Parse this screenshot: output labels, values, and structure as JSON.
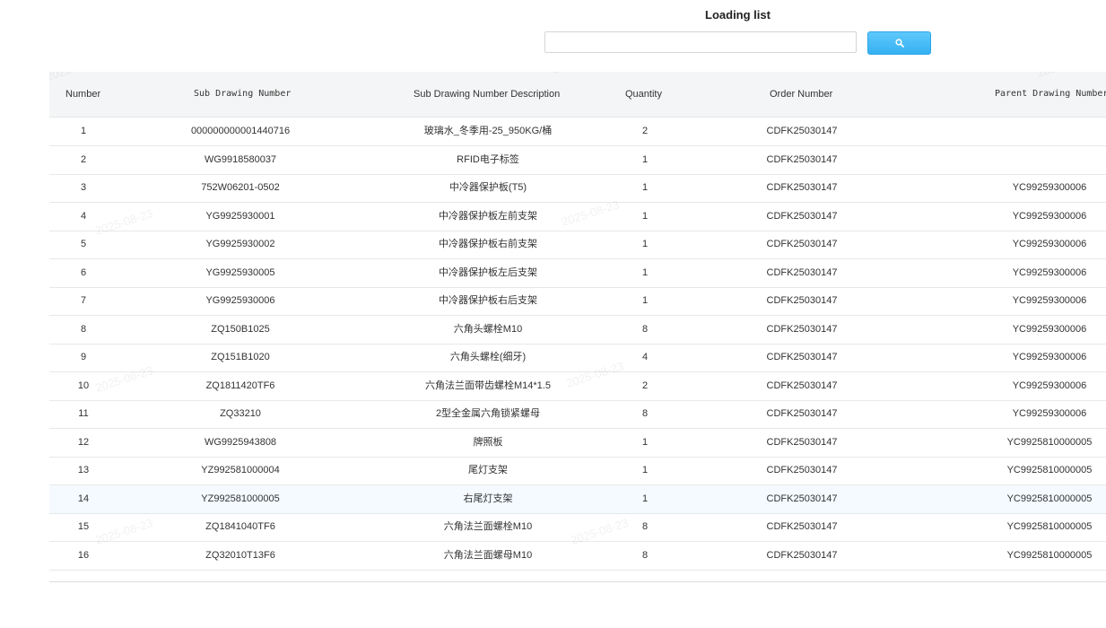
{
  "header": {
    "title": "Loading list"
  },
  "search": {
    "value": "",
    "placeholder": ""
  },
  "colors": {
    "accent": "#3ab4f4",
    "header_bg": "#f4f5f6",
    "highlight_row": "#f4faff"
  },
  "table": {
    "columns": {
      "number": "Number",
      "sub_drawing_number": "Sub Drawing Number",
      "description": "Sub Drawing Number Description",
      "quantity": "Quantity",
      "order_number": "Order Number",
      "parent_drawing_number": "Parent Drawing Number"
    },
    "rows": [
      {
        "number": "1",
        "sub": "000000000001440716",
        "desc": "玻璃水_冬季用-25_950KG/桶",
        "qty": "2",
        "order": "CDFK25030147",
        "parent": ""
      },
      {
        "number": "2",
        "sub": "WG9918580037",
        "desc": "RFID电子标签",
        "qty": "1",
        "order": "CDFK25030147",
        "parent": ""
      },
      {
        "number": "3",
        "sub": "752W06201-0502",
        "desc": "中冷器保护板(T5)",
        "qty": "1",
        "order": "CDFK25030147",
        "parent": "YC99259300006"
      },
      {
        "number": "4",
        "sub": "YG9925930001",
        "desc": "中冷器保护板左前支架",
        "qty": "1",
        "order": "CDFK25030147",
        "parent": "YC99259300006"
      },
      {
        "number": "5",
        "sub": "YG9925930002",
        "desc": "中冷器保护板右前支架",
        "qty": "1",
        "order": "CDFK25030147",
        "parent": "YC99259300006"
      },
      {
        "number": "6",
        "sub": "YG9925930005",
        "desc": "中冷器保护板左后支架",
        "qty": "1",
        "order": "CDFK25030147",
        "parent": "YC99259300006"
      },
      {
        "number": "7",
        "sub": "YG9925930006",
        "desc": "中冷器保护板右后支架",
        "qty": "1",
        "order": "CDFK25030147",
        "parent": "YC99259300006"
      },
      {
        "number": "8",
        "sub": "ZQ150B1025",
        "desc": "六角头螺栓M10",
        "qty": "8",
        "order": "CDFK25030147",
        "parent": "YC99259300006"
      },
      {
        "number": "9",
        "sub": "ZQ151B1020",
        "desc": "六角头螺栓(细牙)",
        "qty": "4",
        "order": "CDFK25030147",
        "parent": "YC99259300006"
      },
      {
        "number": "10",
        "sub": "ZQ1811420TF6",
        "desc": "六角法兰面带齿螺栓M14*1.5",
        "qty": "2",
        "order": "CDFK25030147",
        "parent": "YC99259300006"
      },
      {
        "number": "11",
        "sub": "ZQ33210",
        "desc": "2型全金属六角锁紧螺母",
        "qty": "8",
        "order": "CDFK25030147",
        "parent": "YC99259300006"
      },
      {
        "number": "12",
        "sub": "WG9925943808",
        "desc": "牌照板",
        "qty": "1",
        "order": "CDFK25030147",
        "parent": "YC9925810000005"
      },
      {
        "number": "13",
        "sub": "YZ992581000004",
        "desc": "尾灯支架",
        "qty": "1",
        "order": "CDFK25030147",
        "parent": "YC9925810000005"
      },
      {
        "number": "14",
        "sub": "YZ992581000005",
        "desc": "右尾灯支架",
        "qty": "1",
        "order": "CDFK25030147",
        "parent": "YC9925810000005"
      },
      {
        "number": "15",
        "sub": "ZQ1841040TF6",
        "desc": "六角法兰面螺栓M10",
        "qty": "8",
        "order": "CDFK25030147",
        "parent": "YC9925810000005"
      },
      {
        "number": "16",
        "sub": "ZQ32010T13F6",
        "desc": "六角法兰面螺母M10",
        "qty": "8",
        "order": "CDFK25030147",
        "parent": "YC9925810000005"
      }
    ],
    "highlighted_row": "14"
  },
  "watermark": {
    "text": "2025-08-23"
  }
}
